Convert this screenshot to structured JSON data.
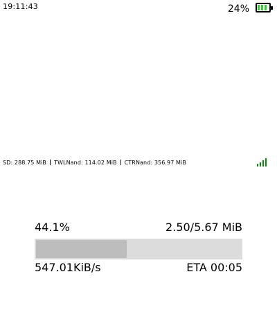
{
  "status": {
    "time": "19:11:43",
    "battery_percent": "24%",
    "battery_level": 0.24
  },
  "storage": {
    "sd": "SD: 288.75 MiB",
    "twlnand": "TWLNand: 114.02 MiB",
    "ctrnand": "CTRNand: 356.97 MiB"
  },
  "wifi": {
    "icon": "signal-bars-icon",
    "color": "#0c8a0c"
  },
  "progress": {
    "percent_label": "44.1%",
    "size_label": "2.50/5.67 MiB",
    "fraction": 0.441,
    "speed": "547.01KiB/s",
    "eta": "ETA 00:05"
  },
  "colors": {
    "progress_fill": "#bdbdbd",
    "progress_track": "#dcdcdc",
    "battery_cell": "#2fd12f"
  }
}
